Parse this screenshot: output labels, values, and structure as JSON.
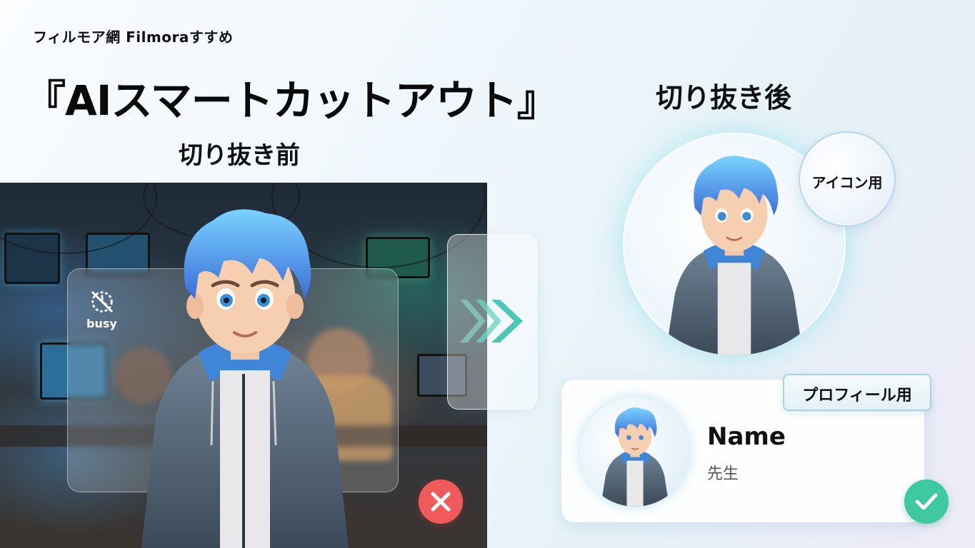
{
  "header": {
    "brand": "フィルモア網 Filmoraすすめ",
    "title": "『AIスマートカットアウト』"
  },
  "before": {
    "label": "切り抜き前",
    "busy_label": "busy",
    "status_icon": "x-icon",
    "status_color": "#ef5b5b"
  },
  "after": {
    "label": "切り抜き後",
    "icon_use_label": "アイコン用",
    "profile_use_label": "プロフィール用",
    "profile": {
      "name": "Name",
      "role": "先生"
    },
    "status_icon": "check-icon",
    "status_color": "#3ec9a0"
  },
  "colors": {
    "hair": "#4a9ee8",
    "hoodie": "#5a6e80",
    "accent_teal": "#5fd0c4"
  }
}
